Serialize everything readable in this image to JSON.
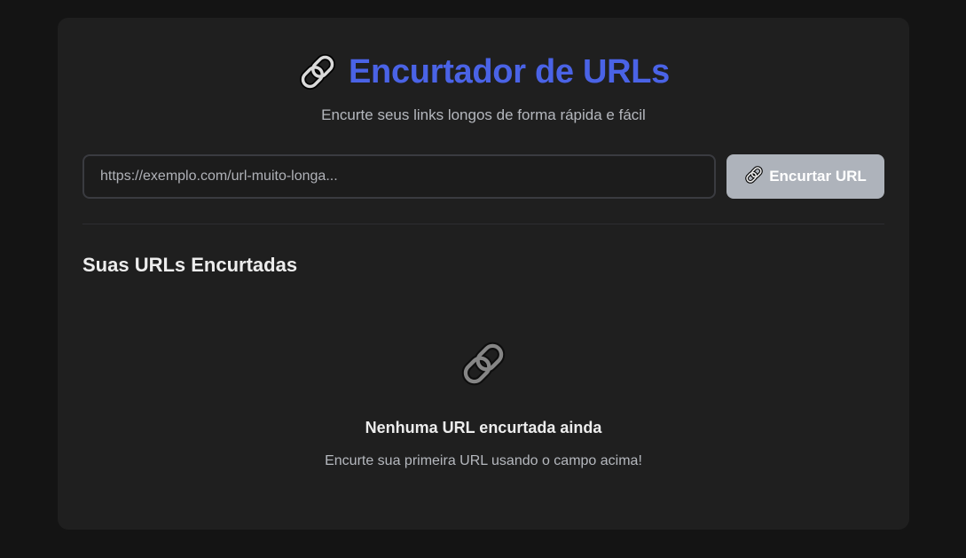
{
  "header": {
    "title": "Encurtador de URLs",
    "subtitle": "Encurte seus links longos de forma rápida e fácil",
    "icon": "link-icon"
  },
  "form": {
    "input_placeholder": "https://exemplo.com/url-muito-longa...",
    "input_value": "",
    "button_label": "Encurtar URL",
    "button_icon": "link-icon"
  },
  "list": {
    "title": "Suas URLs Encurtadas",
    "empty_icon": "link-icon",
    "empty_title": "Nenhuma URL encurtada ainda",
    "empty_description": "Encurte sua primeira URL usando o campo acima!"
  },
  "colors": {
    "accent": "#4a63e6",
    "background": "#141414",
    "card": "#1f1f1f",
    "button_disabled": "#aeb3bb"
  }
}
